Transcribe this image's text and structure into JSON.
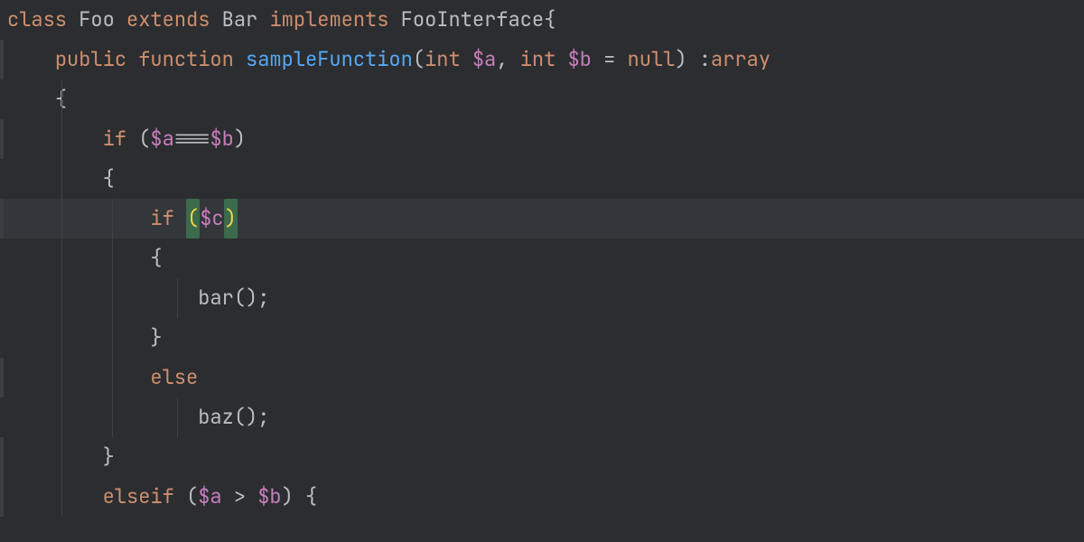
{
  "code": {
    "l1": {
      "class_kw": "class",
      "class_name": "Foo",
      "extends_kw": "extends",
      "parent_name": "Bar",
      "implements_kw": "implements",
      "interface_name": "FooInterface",
      "brace": "{"
    },
    "l2": {
      "vis_kw": "public",
      "fn_kw": "function",
      "fn_name": "sampleFunction",
      "open_paren": "(",
      "type1": "int",
      "param1": "$a",
      "comma": ",",
      "type2": "int",
      "param2": "$b",
      "eq": "=",
      "null_kw": "null",
      "close_paren": ")",
      "colon": ":",
      "return_type": "array"
    },
    "l3": {
      "brace": "{"
    },
    "l4": {
      "if_kw": "if",
      "open_paren": "(",
      "varA": "$a",
      "op": "===",
      "varB": "$b",
      "close_paren": ")"
    },
    "l5": {
      "brace": "{"
    },
    "l6": {
      "if_kw": "if",
      "open_paren": "(",
      "varC": "$c",
      "close_paren": ")"
    },
    "l7": {
      "brace": "{"
    },
    "l8": {
      "call": "bar",
      "open": "(",
      "close": ")",
      "semi": ";"
    },
    "l9": {
      "brace": "}"
    },
    "l10": {
      "else_kw": "else"
    },
    "l11": {
      "call": "baz",
      "open": "(",
      "close": ")",
      "semi": ";"
    },
    "l12": {
      "brace": "}"
    },
    "l13": {
      "elseif_kw": "elseif",
      "open_paren": "(",
      "varA": "$a",
      "op": ">",
      "varB": "$b",
      "close_paren": ")",
      "brace": "{"
    }
  }
}
